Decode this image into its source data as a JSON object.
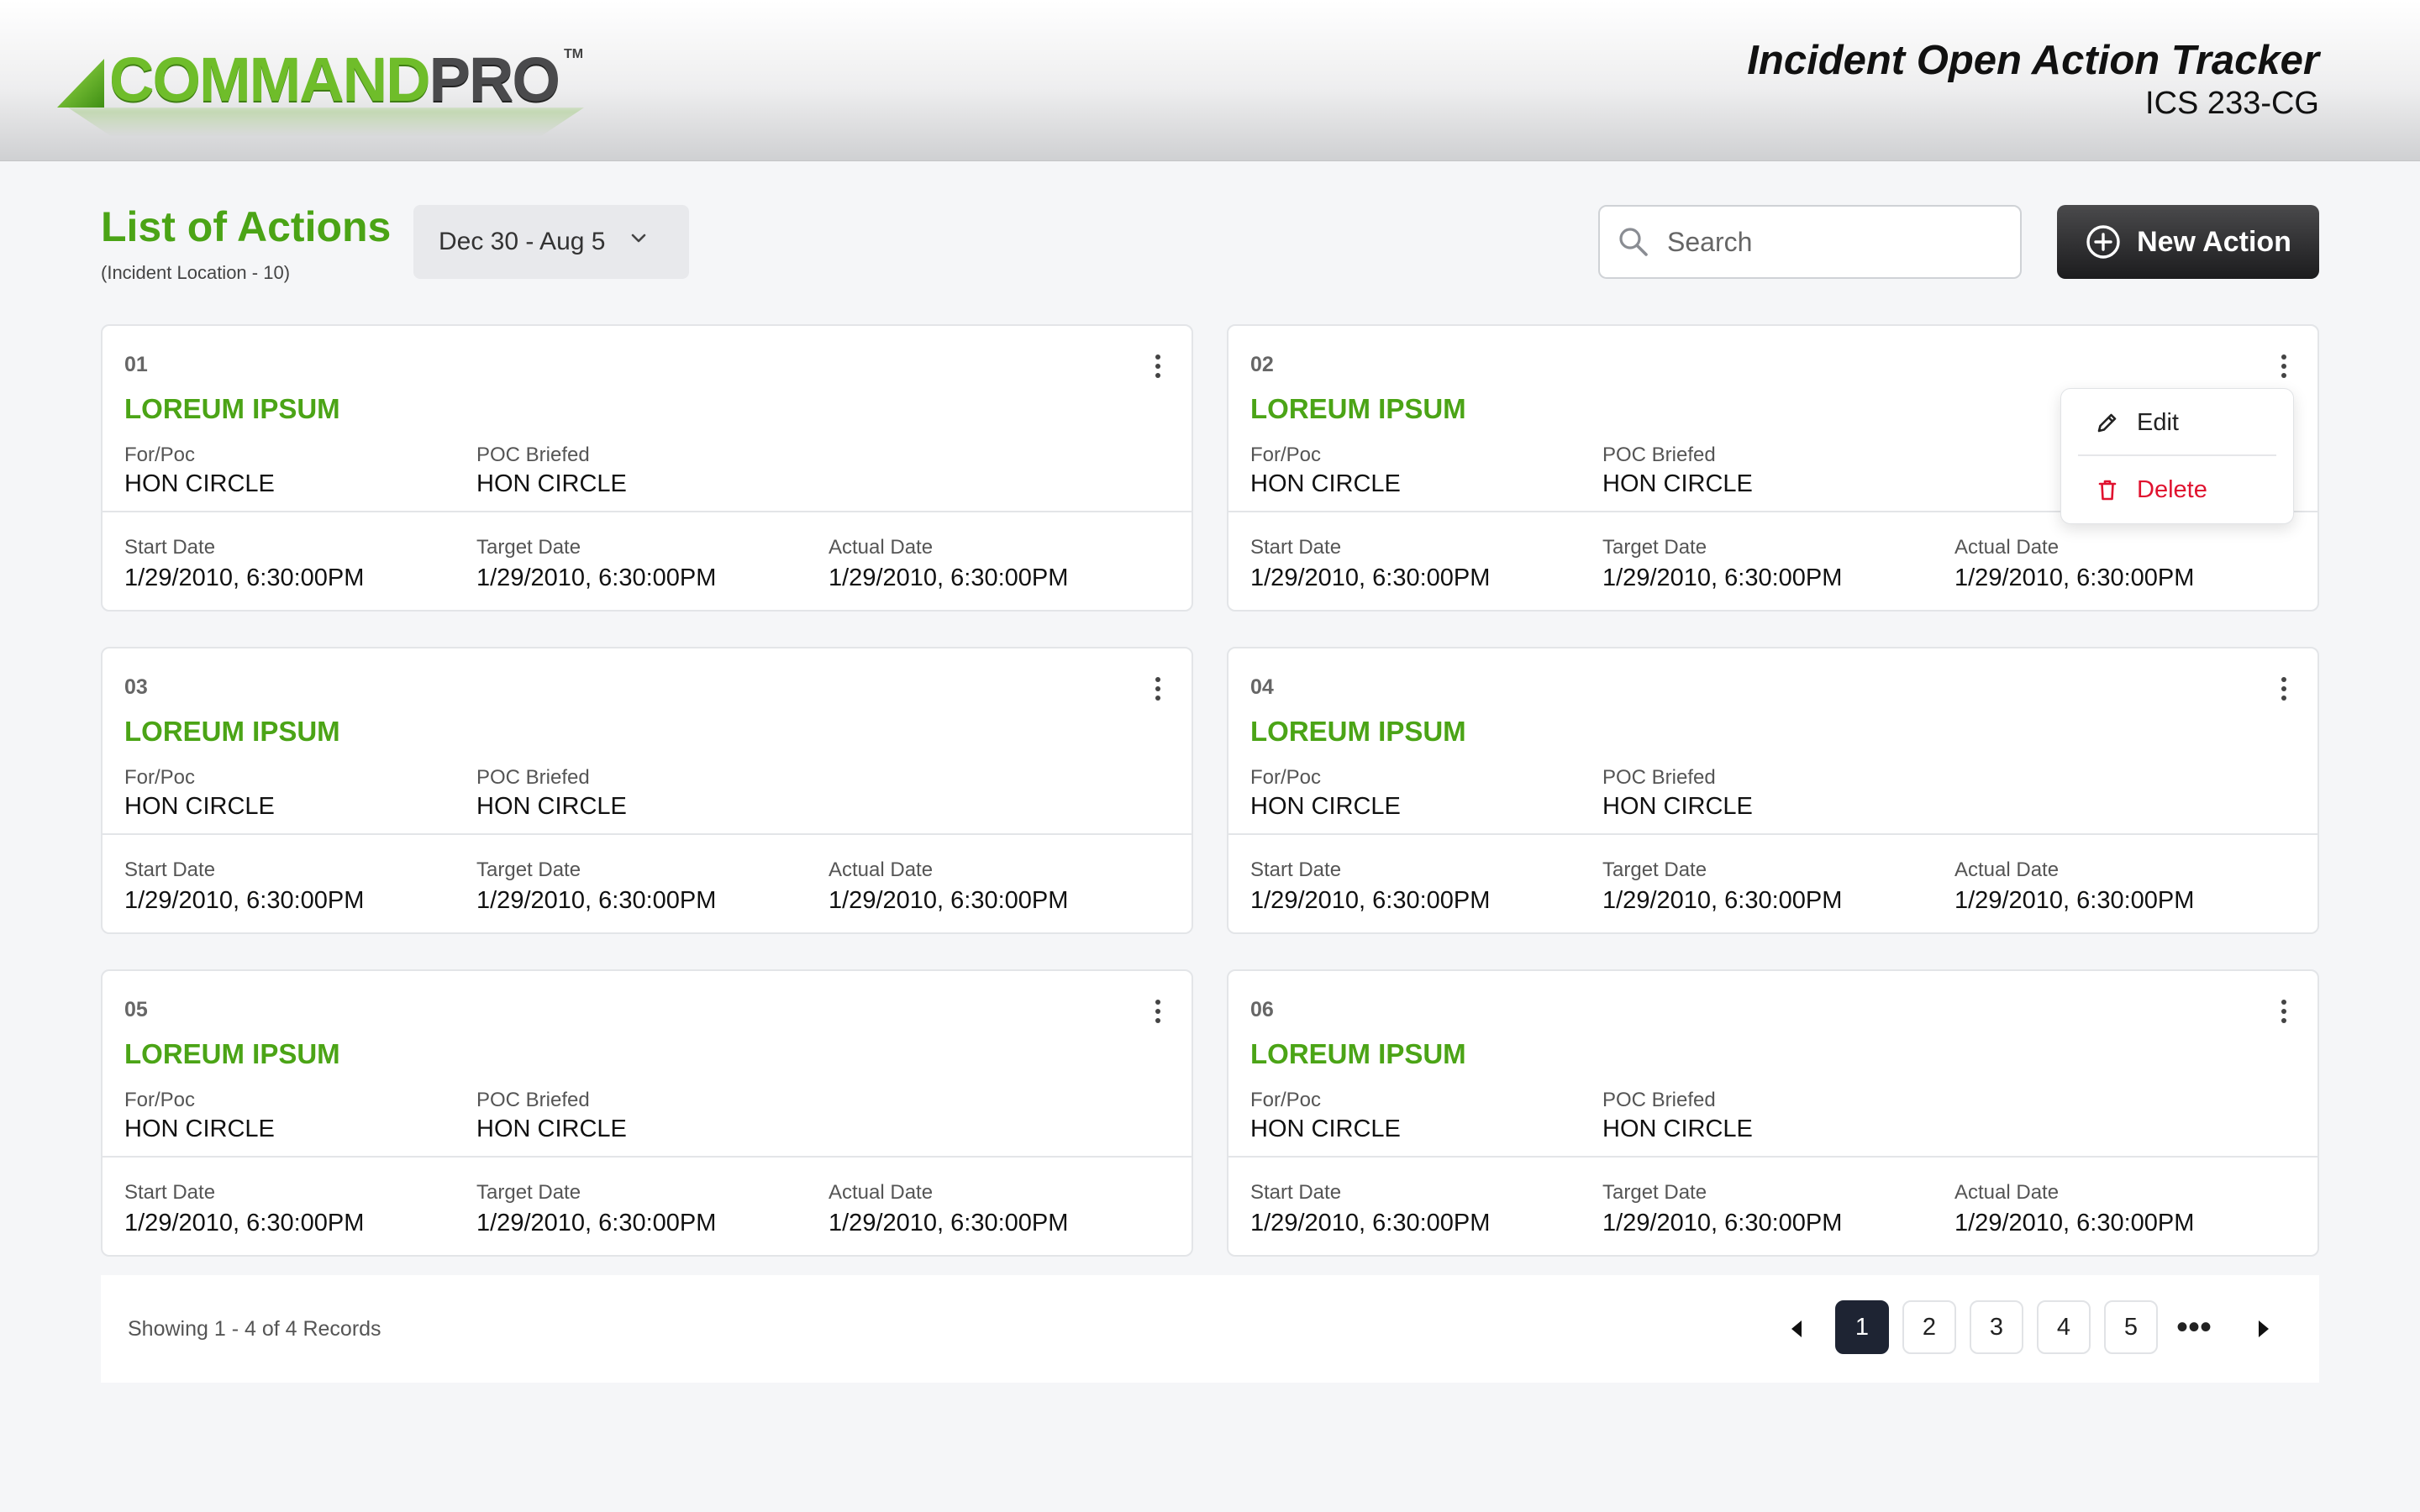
{
  "header": {
    "logo_text_a": "COMMAND",
    "logo_text_b": "PRO",
    "logo_tm": "TM",
    "title": "Incident Open Action Tracker",
    "subtitle": "ICS 233-CG"
  },
  "toolbar": {
    "page_title": "List of Actions",
    "page_subtitle": "(Incident Location - 10)",
    "date_range": "Dec 30 - Aug 5",
    "search_placeholder": "Search",
    "new_action_label": "New Action"
  },
  "labels": {
    "for_poc": "For/Poc",
    "poc_briefed": "POC Briefed",
    "start_date": "Start Date",
    "target_date": "Target Date",
    "actual_date": "Actual Date"
  },
  "cards": [
    {
      "num": "01",
      "title": "LOREUM IPSUM",
      "for_poc": "HON CIRCLE",
      "poc_briefed": "HON CIRCLE",
      "start": "1/29/2010, 6:30:00PM",
      "target": "1/29/2010, 6:30:00PM",
      "actual": "1/29/2010, 6:30:00PM"
    },
    {
      "num": "02",
      "title": "LOREUM IPSUM",
      "for_poc": "HON CIRCLE",
      "poc_briefed": "HON CIRCLE",
      "start": "1/29/2010, 6:30:00PM",
      "target": "1/29/2010, 6:30:00PM",
      "actual": "1/29/2010, 6:30:00PM"
    },
    {
      "num": "03",
      "title": "LOREUM IPSUM",
      "for_poc": "HON CIRCLE",
      "poc_briefed": "HON CIRCLE",
      "start": "1/29/2010, 6:30:00PM",
      "target": "1/29/2010, 6:30:00PM",
      "actual": "1/29/2010, 6:30:00PM"
    },
    {
      "num": "04",
      "title": "LOREUM IPSUM",
      "for_poc": "HON CIRCLE",
      "poc_briefed": "HON CIRCLE",
      "start": "1/29/2010, 6:30:00PM",
      "target": "1/29/2010, 6:30:00PM",
      "actual": "1/29/2010, 6:30:00PM"
    },
    {
      "num": "05",
      "title": "LOREUM IPSUM",
      "for_poc": "HON CIRCLE",
      "poc_briefed": "HON CIRCLE",
      "start": "1/29/2010, 6:30:00PM",
      "target": "1/29/2010, 6:30:00PM",
      "actual": "1/29/2010, 6:30:00PM"
    },
    {
      "num": "06",
      "title": "LOREUM IPSUM",
      "for_poc": "HON CIRCLE",
      "poc_briefed": "HON CIRCLE",
      "start": "1/29/2010, 6:30:00PM",
      "target": "1/29/2010, 6:30:00PM",
      "actual": "1/29/2010, 6:30:00PM"
    }
  ],
  "context_menu": {
    "edit_label": "Edit",
    "delete_label": "Delete"
  },
  "pagination": {
    "records_text": "Showing 1 - 4 of 4 Records",
    "pages": [
      "1",
      "2",
      "3",
      "4",
      "5"
    ],
    "current_page": "1",
    "more": "•••"
  },
  "colors": {
    "accent_green": "#4ba416",
    "delete_red": "#e0122f",
    "active_page": "#1e2433"
  },
  "icons": {
    "search": "search-icon",
    "new_action": "plus-circle-icon",
    "date_dropdown": "chevron-down-icon",
    "card_menu": "kebab-menu-icon",
    "edit": "pencil-icon",
    "delete": "trash-icon",
    "prev": "caret-left-icon",
    "next": "caret-right-icon"
  }
}
